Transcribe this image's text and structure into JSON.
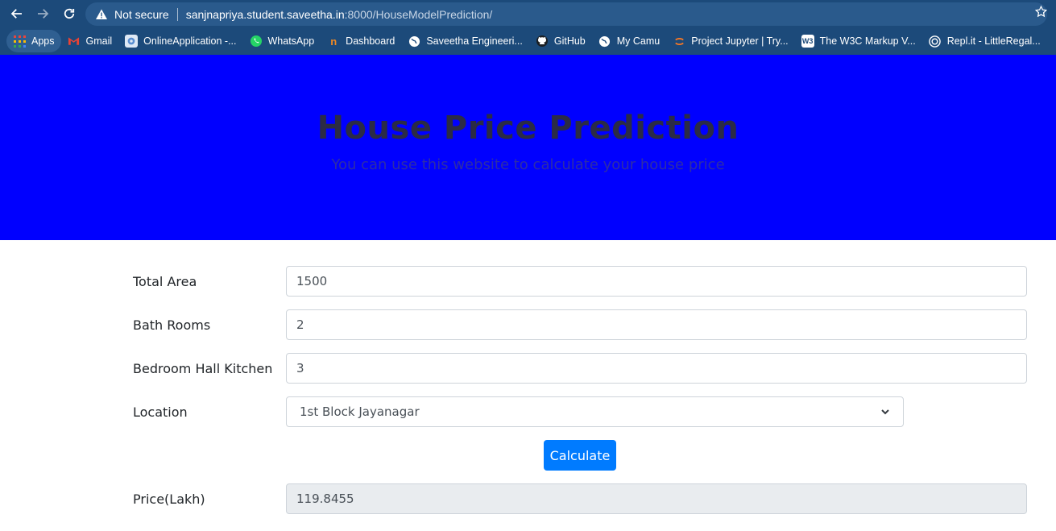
{
  "browser": {
    "security_label": "Not secure",
    "url_host": "sanjnapriya.student.saveetha.in",
    "url_path": ":8000/HouseModelPrediction/",
    "bookmarks": [
      {
        "label": "Apps",
        "icon": "apps-grid-icon",
        "color": "#e8453c"
      },
      {
        "label": "Gmail",
        "icon": "gmail-icon",
        "color": "#ea4335"
      },
      {
        "label": "OnlineApplication -...",
        "icon": "online-application-icon",
        "color": "#5b8fd1"
      },
      {
        "label": "WhatsApp",
        "icon": "whatsapp-icon",
        "color": "#25d366"
      },
      {
        "label": "Dashboard",
        "icon": "dashboard-icon",
        "color": "#f08a24"
      },
      {
        "label": "Saveetha Engineeri...",
        "icon": "globe-icon",
        "color": "#ffffff"
      },
      {
        "label": "GitHub",
        "icon": "github-icon",
        "color": "#ffffff"
      },
      {
        "label": "My Camu",
        "icon": "globe-icon",
        "color": "#ffffff"
      },
      {
        "label": "Project Jupyter | Try...",
        "icon": "jupyter-icon",
        "color": "#f37726"
      },
      {
        "label": "The W3C Markup V...",
        "icon": "w3c-icon",
        "color": "#ffffff"
      },
      {
        "label": "Repl.it - LittleRegal...",
        "icon": "replit-icon",
        "color": "#ffffff"
      }
    ]
  },
  "header": {
    "title": "House Price Prediction",
    "subtitle": "You can use this website to calculate your house price"
  },
  "form": {
    "total_area": {
      "label": "Total Area",
      "value": "1500"
    },
    "bath_rooms": {
      "label": "Bath Rooms",
      "value": "2"
    },
    "bhk": {
      "label": "Bedroom Hall Kitchen",
      "value": "3"
    },
    "location": {
      "label": "Location",
      "value": "1st Block Jayanagar"
    },
    "calculate_label": "Calculate",
    "price": {
      "label": "Price(Lakh)",
      "value": "119.8455"
    }
  },
  "colors": {
    "chrome": "#1c4a7a",
    "hero": "#0000ff",
    "button": "#007bff"
  }
}
